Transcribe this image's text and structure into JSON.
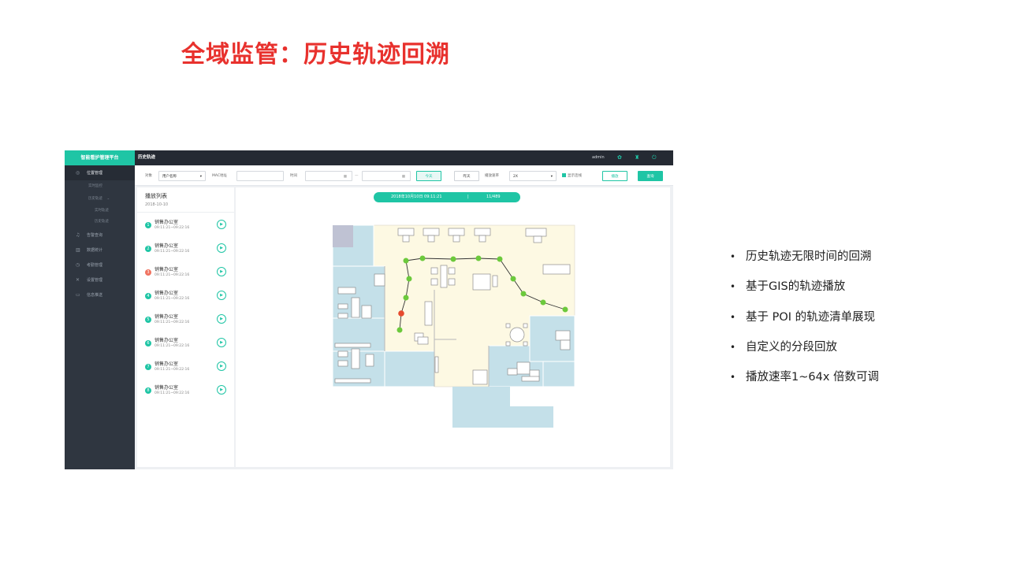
{
  "slide": {
    "title": "全域监管：历史轨迹回溯",
    "bullets": [
      "历史轨迹无限时间的回溯",
      "基于GIS的轨迹播放",
      "基于 POI 的轨迹清单展现",
      "自定义的分段回放",
      "播放速率1~64x 倍数可调"
    ]
  },
  "app": {
    "brand": "智能看护管理平台",
    "page_title": "历史轨迹",
    "user": "admin",
    "icons": [
      "gear-icon",
      "shirt-icon",
      "power-icon"
    ],
    "accent_color": "#1fc5a5",
    "sidebar": {
      "items": [
        {
          "label": "位置管理",
          "icon": "location-icon"
        },
        {
          "label": "告警查询",
          "icon": "bell-icon"
        },
        {
          "label": "数据统计",
          "icon": "chart-icon"
        },
        {
          "label": "考勤管理",
          "icon": "clock-icon"
        },
        {
          "label": "设置管理",
          "icon": "wrench-icon"
        },
        {
          "label": "信息推送",
          "icon": "message-icon"
        }
      ],
      "sub": [
        "实时监控",
        "历史轨迹"
      ],
      "sub2": [
        "实时轨迹",
        "历史轨迹"
      ]
    },
    "filter": {
      "object_label": "对象",
      "object_value": "用户名称",
      "mac_label": "MAC地址",
      "mac_value": "",
      "time_label": "时间",
      "time_start": "",
      "time_end": "",
      "range_sep": "—",
      "today_button": "今天",
      "yesterday_button": "昨天",
      "speed_label": "播放速率",
      "speed_value": "2X",
      "show_line_label": "显示连线",
      "play_button": "播放",
      "query_button": "查询"
    },
    "list": {
      "title": "播放列表",
      "date": "2018-10-10",
      "items": [
        {
          "num": "1",
          "name": "销售办公室",
          "time": "09:11:21~09:22:16",
          "alert": false
        },
        {
          "num": "2",
          "name": "销售办公室",
          "time": "09:11:21~09:22:16",
          "alert": false
        },
        {
          "num": "3",
          "name": "销售办公室",
          "time": "09:11:21~09:22:16",
          "alert": true
        },
        {
          "num": "4",
          "name": "销售办公室",
          "time": "09:11:21~09:22:16",
          "alert": false
        },
        {
          "num": "5",
          "name": "销售办公室",
          "time": "09:11:21~09:22:16",
          "alert": false
        },
        {
          "num": "6",
          "name": "销售办公室",
          "time": "09:11:21~09:22:16",
          "alert": false
        },
        {
          "num": "7",
          "name": "销售办公室",
          "time": "09:11:21~09:22:16",
          "alert": false
        },
        {
          "num": "8",
          "name": "销售办公室",
          "time": "09:11:21~09:22:16",
          "alert": false
        }
      ]
    },
    "map": {
      "datetime": "2018年10月10日 09:11:21",
      "separator": "|",
      "counter": "11/489"
    }
  }
}
